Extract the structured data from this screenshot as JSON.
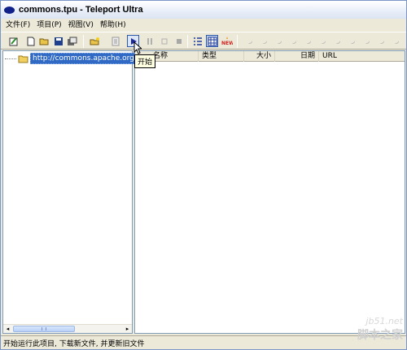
{
  "window": {
    "title": "commons.tpu - Teleport Ultra"
  },
  "menu": [
    {
      "label": "文件(F)"
    },
    {
      "label": "项目(P)"
    },
    {
      "label": "视图(V)"
    },
    {
      "label": "帮助(H)"
    }
  ],
  "toolbar": {
    "tooltip": "开始"
  },
  "tree": {
    "root_label": "http://commons.apache.org"
  },
  "list": {
    "columns": [
      "名称",
      "类型",
      "大小",
      "日期",
      "URL"
    ]
  },
  "scrollbar": {
    "thumb_label": "III"
  },
  "status": {
    "text": "开始运行此项目, 下载新文件, 并更新旧文件"
  },
  "watermark": {
    "line1": "jb51.net",
    "line2": "脚本之家"
  },
  "colors": {
    "selection": "#316ac5",
    "tooltip_bg": "#ffffe1",
    "chrome": "#ece9d8"
  }
}
